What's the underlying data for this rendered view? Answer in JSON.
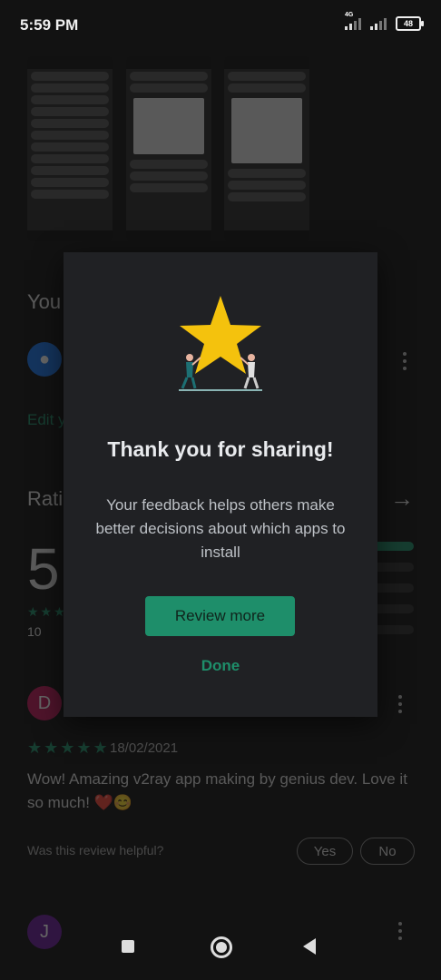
{
  "status_bar": {
    "time": "5:59 PM",
    "network_type": "4G",
    "battery": "48"
  },
  "background": {
    "your_review_title": "You",
    "edit_link": "Edit y",
    "ratings_title": "Rati",
    "rating_value": "5",
    "rating_count": "10",
    "rating_distribution": [
      0.95,
      0.0,
      0.0,
      0.0,
      0.0
    ],
    "review": {
      "avatar_letter": "D",
      "stars": "★★★★★",
      "date": "18/02/2021",
      "text": "Wow! Amazing v2ray app making by genius dev. Love it so much! ❤️😊",
      "helpful_question": "Was this review helpful?",
      "yes_label": "Yes",
      "no_label": "No"
    },
    "next_avatar_letter": "J"
  },
  "dialog": {
    "title": "Thank you for sharing!",
    "message": "Your feedback helps others make better decisions about which apps to install",
    "review_more_label": "Review more",
    "done_label": "Done",
    "star_color": "#f4c20d",
    "accent_color": "#1e8e6a"
  }
}
